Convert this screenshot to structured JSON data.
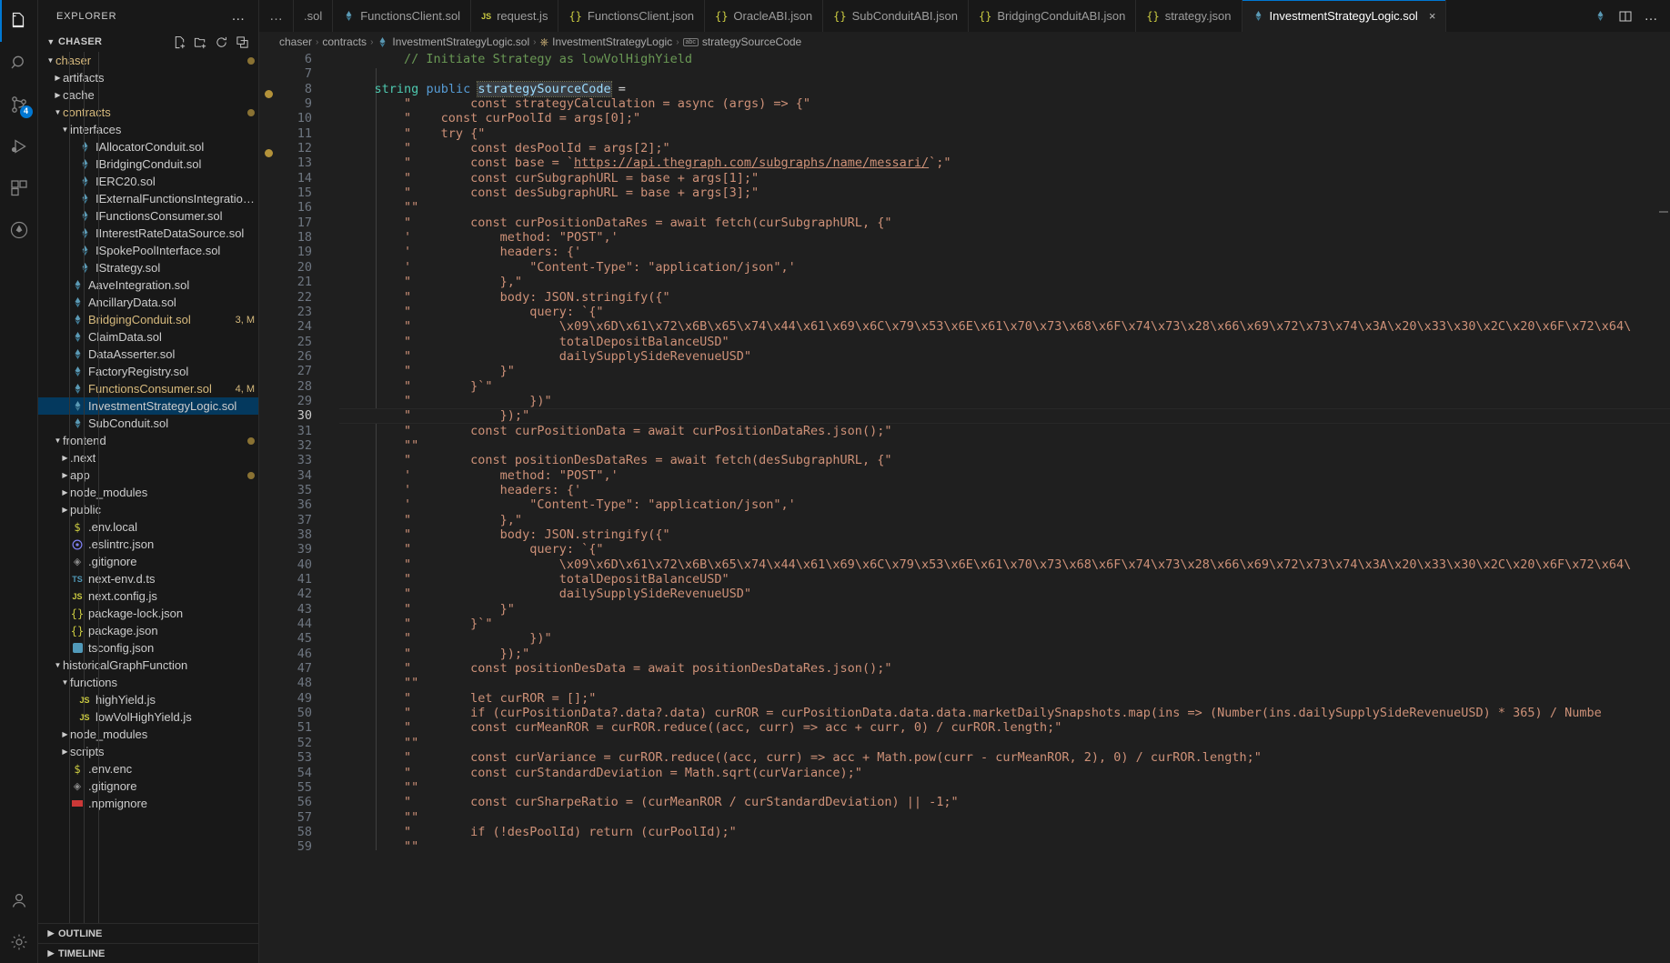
{
  "activitybar": {
    "items": [
      {
        "name": "explorer",
        "icon": "files-icon",
        "active": true,
        "badge": null
      },
      {
        "name": "search",
        "icon": "search-icon",
        "active": false,
        "badge": null
      },
      {
        "name": "source-control",
        "icon": "source-control-icon",
        "active": false,
        "badge": "4"
      },
      {
        "name": "run-and-debug",
        "icon": "run-debug-icon",
        "active": false,
        "badge": null
      },
      {
        "name": "extensions",
        "icon": "extensions-icon",
        "active": false,
        "badge": null
      },
      {
        "name": "solidity",
        "icon": "solidity-diamond-icon",
        "active": false,
        "badge": null
      }
    ],
    "bottom": [
      {
        "name": "accounts",
        "icon": "account-icon"
      },
      {
        "name": "settings",
        "icon": "gear-icon"
      }
    ]
  },
  "sidebar": {
    "title": "EXPLORER",
    "overflow_label": "…",
    "root": {
      "label": "CHASER",
      "actions": [
        "new-file-icon",
        "new-folder-icon",
        "refresh-icon",
        "collapse-all-icon"
      ]
    },
    "tree": [
      {
        "label": "chaser",
        "depth": 0,
        "type": "folder",
        "open": true,
        "color": "folder-y",
        "dot": "dim"
      },
      {
        "label": "artifacts",
        "depth": 1,
        "type": "folder",
        "open": false,
        "color": "folder"
      },
      {
        "label": "cache",
        "depth": 1,
        "type": "folder",
        "open": false,
        "color": "folder"
      },
      {
        "label": "contracts",
        "depth": 1,
        "type": "folder",
        "open": true,
        "color": "folder-y",
        "dot": "dim"
      },
      {
        "label": "interfaces",
        "depth": 2,
        "type": "folder",
        "open": true,
        "color": "folder"
      },
      {
        "label": "IAllocatorConduit.sol",
        "depth": 3,
        "type": "sol"
      },
      {
        "label": "IBridgingConduit.sol",
        "depth": 3,
        "type": "sol"
      },
      {
        "label": "IERC20.sol",
        "depth": 3,
        "type": "sol"
      },
      {
        "label": "IExternalFunctionsIntegration.sol",
        "depth": 3,
        "type": "sol"
      },
      {
        "label": "IFunctionsConsumer.sol",
        "depth": 3,
        "type": "sol"
      },
      {
        "label": "IInterestRateDataSource.sol",
        "depth": 3,
        "type": "sol"
      },
      {
        "label": "ISpokePoolInterface.sol",
        "depth": 3,
        "type": "sol"
      },
      {
        "label": "IStrategy.sol",
        "depth": 3,
        "type": "sol"
      },
      {
        "label": "AaveIntegration.sol",
        "depth": 2,
        "type": "sol"
      },
      {
        "label": "AncillaryData.sol",
        "depth": 2,
        "type": "sol"
      },
      {
        "label": "BridgingConduit.sol",
        "depth": 2,
        "type": "sol",
        "modified": true,
        "badge": "3, M"
      },
      {
        "label": "ClaimData.sol",
        "depth": 2,
        "type": "sol"
      },
      {
        "label": "DataAsserter.sol",
        "depth": 2,
        "type": "sol"
      },
      {
        "label": "FactoryRegistry.sol",
        "depth": 2,
        "type": "sol"
      },
      {
        "label": "FunctionsConsumer.sol",
        "depth": 2,
        "type": "sol",
        "modified": true,
        "badge": "4, M"
      },
      {
        "label": "InvestmentStrategyLogic.sol",
        "depth": 2,
        "type": "sol",
        "selected": true
      },
      {
        "label": "SubConduit.sol",
        "depth": 2,
        "type": "sol"
      },
      {
        "label": "frontend",
        "depth": 1,
        "type": "folder",
        "open": true,
        "color": "folder",
        "dot": "dim"
      },
      {
        "label": ".next",
        "depth": 2,
        "type": "folder",
        "open": false,
        "color": "folder"
      },
      {
        "label": "app",
        "depth": 2,
        "type": "folder",
        "open": false,
        "color": "folder",
        "dot": "dim"
      },
      {
        "label": "node_modules",
        "depth": 2,
        "type": "folder",
        "open": false,
        "color": "folder"
      },
      {
        "label": "public",
        "depth": 2,
        "type": "folder",
        "open": false,
        "color": "folder"
      },
      {
        "label": ".env.local",
        "depth": 2,
        "type": "env"
      },
      {
        "label": ".eslintrc.json",
        "depth": 2,
        "type": "eslint"
      },
      {
        "label": ".gitignore",
        "depth": 2,
        "type": "git"
      },
      {
        "label": "next-env.d.ts",
        "depth": 2,
        "type": "ts"
      },
      {
        "label": "next.config.js",
        "depth": 2,
        "type": "js"
      },
      {
        "label": "package-lock.json",
        "depth": 2,
        "type": "json"
      },
      {
        "label": "package.json",
        "depth": 2,
        "type": "json"
      },
      {
        "label": "tsconfig.json",
        "depth": 2,
        "type": "tsconfig"
      },
      {
        "label": "historicalGraphFunction",
        "depth": 1,
        "type": "folder",
        "open": true,
        "color": "folder"
      },
      {
        "label": "functions",
        "depth": 2,
        "type": "folder",
        "open": true,
        "color": "folder"
      },
      {
        "label": "highYield.js",
        "depth": 3,
        "type": "js"
      },
      {
        "label": "lowVolHighYield.js",
        "depth": 3,
        "type": "js"
      },
      {
        "label": "node_modules",
        "depth": 2,
        "type": "folder",
        "open": false,
        "color": "folder"
      },
      {
        "label": "scripts",
        "depth": 2,
        "type": "folder",
        "open": false,
        "color": "folder"
      },
      {
        "label": ".env.enc",
        "depth": 2,
        "type": "env"
      },
      {
        "label": ".gitignore",
        "depth": 2,
        "type": "git"
      },
      {
        "label": ".npmignore",
        "depth": 2,
        "type": "npm"
      }
    ],
    "panels": [
      {
        "label": "OUTLINE"
      },
      {
        "label": "TIMELINE"
      }
    ]
  },
  "tabs": {
    "leading_overflow": "…",
    "items": [
      {
        "label": ".sol",
        "icon": "sol-icon",
        "active": false,
        "truncated": true
      },
      {
        "label": "FunctionsClient.sol",
        "icon": "sol-icon",
        "active": false
      },
      {
        "label": "request.js",
        "icon": "js-icon",
        "active": false
      },
      {
        "label": "FunctionsClient.json",
        "icon": "json-icon",
        "active": false
      },
      {
        "label": "OracleABI.json",
        "icon": "json-icon",
        "active": false
      },
      {
        "label": "SubConduitABI.json",
        "icon": "json-icon",
        "active": false
      },
      {
        "label": "BridgingConduitABI.json",
        "icon": "json-icon",
        "active": false
      },
      {
        "label": "strategy.json",
        "icon": "json-icon",
        "active": false
      },
      {
        "label": "InvestmentStrategyLogic.sol",
        "icon": "sol-icon",
        "active": true,
        "close": "×"
      }
    ],
    "actions": [
      "sol-icon",
      "split-editor-icon",
      "more-actions-icon"
    ]
  },
  "breadcrumb": {
    "items": [
      {
        "label": "chaser",
        "icon": null
      },
      {
        "label": "contracts",
        "icon": null
      },
      {
        "label": "InvestmentStrategyLogic.sol",
        "icon": "sol-icon"
      },
      {
        "label": "InvestmentStrategyLogic",
        "icon": "contract-icon"
      },
      {
        "label": "strategySourceCode",
        "icon": "property-icon"
      }
    ],
    "separator": "›"
  },
  "editor": {
    "current_line": 30,
    "selected_symbol": "strategySourceCode",
    "first_line_number": 6,
    "lines": [
      {
        "n": 6,
        "tokens": [
          {
            "t": "        ",
            "c": "t-pln"
          },
          {
            "t": "// Initiate Strategy as lowVolHighYield",
            "c": "t-com"
          }
        ]
      },
      {
        "n": 7,
        "tokens": []
      },
      {
        "n": 8,
        "tokens": [
          {
            "t": "    ",
            "c": "t-pln"
          },
          {
            "t": "string",
            "c": "t-type"
          },
          {
            "t": " ",
            "c": "t-pln"
          },
          {
            "t": "public",
            "c": "t-kw"
          },
          {
            "t": " ",
            "c": "t-pln"
          },
          {
            "t": "strategySourceCode",
            "c": "t-var sel-occ"
          },
          {
            "t": " =",
            "c": "t-pln"
          }
        ]
      },
      {
        "n": 9,
        "tokens": [
          {
            "t": "        \"        const strategyCalculation = async (args) => {\"",
            "c": "t-str"
          }
        ]
      },
      {
        "n": 10,
        "tokens": [
          {
            "t": "        \"    const curPoolId = args[0];\"",
            "c": "t-str"
          }
        ]
      },
      {
        "n": 11,
        "tokens": [
          {
            "t": "        \"    try {\"",
            "c": "t-str"
          }
        ]
      },
      {
        "n": 12,
        "tokens": [
          {
            "t": "        \"        const desPoolId = args[2];\"",
            "c": "t-str"
          }
        ]
      },
      {
        "n": 13,
        "tokens": [
          {
            "t": "        \"        const base = `",
            "c": "t-str"
          },
          {
            "t": "https://api.thegraph.com/subgraphs/name/messari/",
            "c": "t-lnk"
          },
          {
            "t": "`;\"",
            "c": "t-str"
          }
        ]
      },
      {
        "n": 14,
        "tokens": [
          {
            "t": "        \"        const curSubgraphURL = base + args[1];\"",
            "c": "t-str"
          }
        ]
      },
      {
        "n": 15,
        "tokens": [
          {
            "t": "        \"        const desSubgraphURL = base + args[3];\"",
            "c": "t-str"
          }
        ]
      },
      {
        "n": 16,
        "tokens": [
          {
            "t": "        \"\"",
            "c": "t-str"
          }
        ]
      },
      {
        "n": 17,
        "tokens": [
          {
            "t": "        \"        const curPositionDataRes = await fetch(curSubgraphURL, {\"",
            "c": "t-str"
          }
        ]
      },
      {
        "n": 18,
        "tokens": [
          {
            "t": "        '            method: \"POST\",'",
            "c": "t-str"
          }
        ]
      },
      {
        "n": 19,
        "tokens": [
          {
            "t": "        '            headers: {'",
            "c": "t-str"
          }
        ]
      },
      {
        "n": 20,
        "tokens": [
          {
            "t": "        '                \"Content-Type\": \"application/json\",'",
            "c": "t-str"
          }
        ]
      },
      {
        "n": 21,
        "tokens": [
          {
            "t": "        \"            },\"",
            "c": "t-str"
          }
        ]
      },
      {
        "n": 22,
        "tokens": [
          {
            "t": "        \"            body: JSON.stringify({\"",
            "c": "t-str"
          }
        ]
      },
      {
        "n": 23,
        "tokens": [
          {
            "t": "        \"                query: `{\"",
            "c": "t-str"
          }
        ]
      },
      {
        "n": 24,
        "tokens": [
          {
            "t": "        \"                    \\x09\\x6D\\x61\\x72\\x6B\\x65\\x74\\x44\\x61\\x69\\x6C\\x79\\x53\\x6E\\x61\\x70\\x73\\x68\\x6F\\x74\\x73\\x28\\x66\\x69\\x72\\x73\\x74\\x3A\\x20\\x33\\x30\\x2C\\x20\\x6F\\x72\\x64\\",
            "c": "t-str"
          }
        ]
      },
      {
        "n": 25,
        "tokens": [
          {
            "t": "        \"                    totalDepositBalanceUSD\"",
            "c": "t-str"
          }
        ]
      },
      {
        "n": 26,
        "tokens": [
          {
            "t": "        \"                    dailySupplySideRevenueUSD\"",
            "c": "t-str"
          }
        ]
      },
      {
        "n": 27,
        "tokens": [
          {
            "t": "        \"            }\"",
            "c": "t-str"
          }
        ]
      },
      {
        "n": 28,
        "tokens": [
          {
            "t": "        \"        }`\"",
            "c": "t-str"
          }
        ]
      },
      {
        "n": 29,
        "tokens": [
          {
            "t": "        \"                })\"",
            "c": "t-str"
          }
        ]
      },
      {
        "n": 30,
        "tokens": [
          {
            "t": "        \"            });\"",
            "c": "t-str"
          }
        ],
        "current": true
      },
      {
        "n": 31,
        "tokens": [
          {
            "t": "        \"        const curPositionData = await curPositionDataRes.json();\"",
            "c": "t-str"
          }
        ]
      },
      {
        "n": 32,
        "tokens": [
          {
            "t": "        \"\"",
            "c": "t-str"
          }
        ]
      },
      {
        "n": 33,
        "tokens": [
          {
            "t": "        \"        const positionDesDataRes = await fetch(desSubgraphURL, {\"",
            "c": "t-str"
          }
        ]
      },
      {
        "n": 34,
        "tokens": [
          {
            "t": "        '            method: \"POST\",'",
            "c": "t-str"
          }
        ]
      },
      {
        "n": 35,
        "tokens": [
          {
            "t": "        '            headers: {'",
            "c": "t-str"
          }
        ]
      },
      {
        "n": 36,
        "tokens": [
          {
            "t": "        '                \"Content-Type\": \"application/json\",'",
            "c": "t-str"
          }
        ]
      },
      {
        "n": 37,
        "tokens": [
          {
            "t": "        \"            },\"",
            "c": "t-str"
          }
        ]
      },
      {
        "n": 38,
        "tokens": [
          {
            "t": "        \"            body: JSON.stringify({\"",
            "c": "t-str"
          }
        ]
      },
      {
        "n": 39,
        "tokens": [
          {
            "t": "        \"                query: `{\"",
            "c": "t-str"
          }
        ]
      },
      {
        "n": 40,
        "tokens": [
          {
            "t": "        \"                    \\x09\\x6D\\x61\\x72\\x6B\\x65\\x74\\x44\\x61\\x69\\x6C\\x79\\x53\\x6E\\x61\\x70\\x73\\x68\\x6F\\x74\\x73\\x28\\x66\\x69\\x72\\x73\\x74\\x3A\\x20\\x33\\x30\\x2C\\x20\\x6F\\x72\\x64\\",
            "c": "t-str"
          }
        ]
      },
      {
        "n": 41,
        "tokens": [
          {
            "t": "        \"                    totalDepositBalanceUSD\"",
            "c": "t-str"
          }
        ]
      },
      {
        "n": 42,
        "tokens": [
          {
            "t": "        \"                    dailySupplySideRevenueUSD\"",
            "c": "t-str"
          }
        ]
      },
      {
        "n": 43,
        "tokens": [
          {
            "t": "        \"            }\"",
            "c": "t-str"
          }
        ]
      },
      {
        "n": 44,
        "tokens": [
          {
            "t": "        \"        }`\"",
            "c": "t-str"
          }
        ]
      },
      {
        "n": 45,
        "tokens": [
          {
            "t": "        \"                })\"",
            "c": "t-str"
          }
        ]
      },
      {
        "n": 46,
        "tokens": [
          {
            "t": "        \"            });\"",
            "c": "t-str"
          }
        ]
      },
      {
        "n": 47,
        "tokens": [
          {
            "t": "        \"        const positionDesData = await positionDesDataRes.json();\"",
            "c": "t-str"
          }
        ]
      },
      {
        "n": 48,
        "tokens": [
          {
            "t": "        \"\"",
            "c": "t-str"
          }
        ]
      },
      {
        "n": 49,
        "tokens": [
          {
            "t": "        \"        let curROR = [];\"",
            "c": "t-str"
          }
        ]
      },
      {
        "n": 50,
        "tokens": [
          {
            "t": "        \"        if (curPositionData?.data?.data) curROR = curPositionData.data.data.marketDailySnapshots.map(ins => (Number(ins.dailySupplySideRevenueUSD) * 365) / Numbe",
            "c": "t-str"
          }
        ]
      },
      {
        "n": 51,
        "tokens": [
          {
            "t": "        \"        const curMeanROR = curROR.reduce((acc, curr) => acc + curr, 0) / curROR.length;\"",
            "c": "t-str"
          }
        ]
      },
      {
        "n": 52,
        "tokens": [
          {
            "t": "        \"\"",
            "c": "t-str"
          }
        ]
      },
      {
        "n": 53,
        "tokens": [
          {
            "t": "        \"        const curVariance = curROR.reduce((acc, curr) => acc + Math.pow(curr - curMeanROR, 2), 0) / curROR.length;\"",
            "c": "t-str"
          }
        ]
      },
      {
        "n": 54,
        "tokens": [
          {
            "t": "        \"        const curStandardDeviation = Math.sqrt(curVariance);\"",
            "c": "t-str"
          }
        ]
      },
      {
        "n": 55,
        "tokens": [
          {
            "t": "        \"\"",
            "c": "t-str"
          }
        ]
      },
      {
        "n": 56,
        "tokens": [
          {
            "t": "        \"        const curSharpeRatio = (curMeanROR / curStandardDeviation) || -1;\"",
            "c": "t-str"
          }
        ]
      },
      {
        "n": 57,
        "tokens": [
          {
            "t": "        \"\"",
            "c": "t-str"
          }
        ]
      },
      {
        "n": 58,
        "tokens": [
          {
            "t": "        \"        if (!desPoolId) return (curPoolId);\"",
            "c": "t-str"
          }
        ]
      },
      {
        "n": 59,
        "tokens": [
          {
            "t": "        \"\"",
            "c": "t-str"
          }
        ]
      }
    ]
  },
  "colors": {
    "accent": "#0078d4",
    "editor_bg": "#1f1f1f",
    "sidebar_bg": "#181818",
    "activitybar_bg": "#181818",
    "string": "#ce9178",
    "comment": "#6a9955",
    "keyword": "#569cd6",
    "type": "#4ec9b0",
    "variable": "#9cdcfe",
    "modified_file": "#d7ba7d",
    "selected_row": "#04395e"
  }
}
